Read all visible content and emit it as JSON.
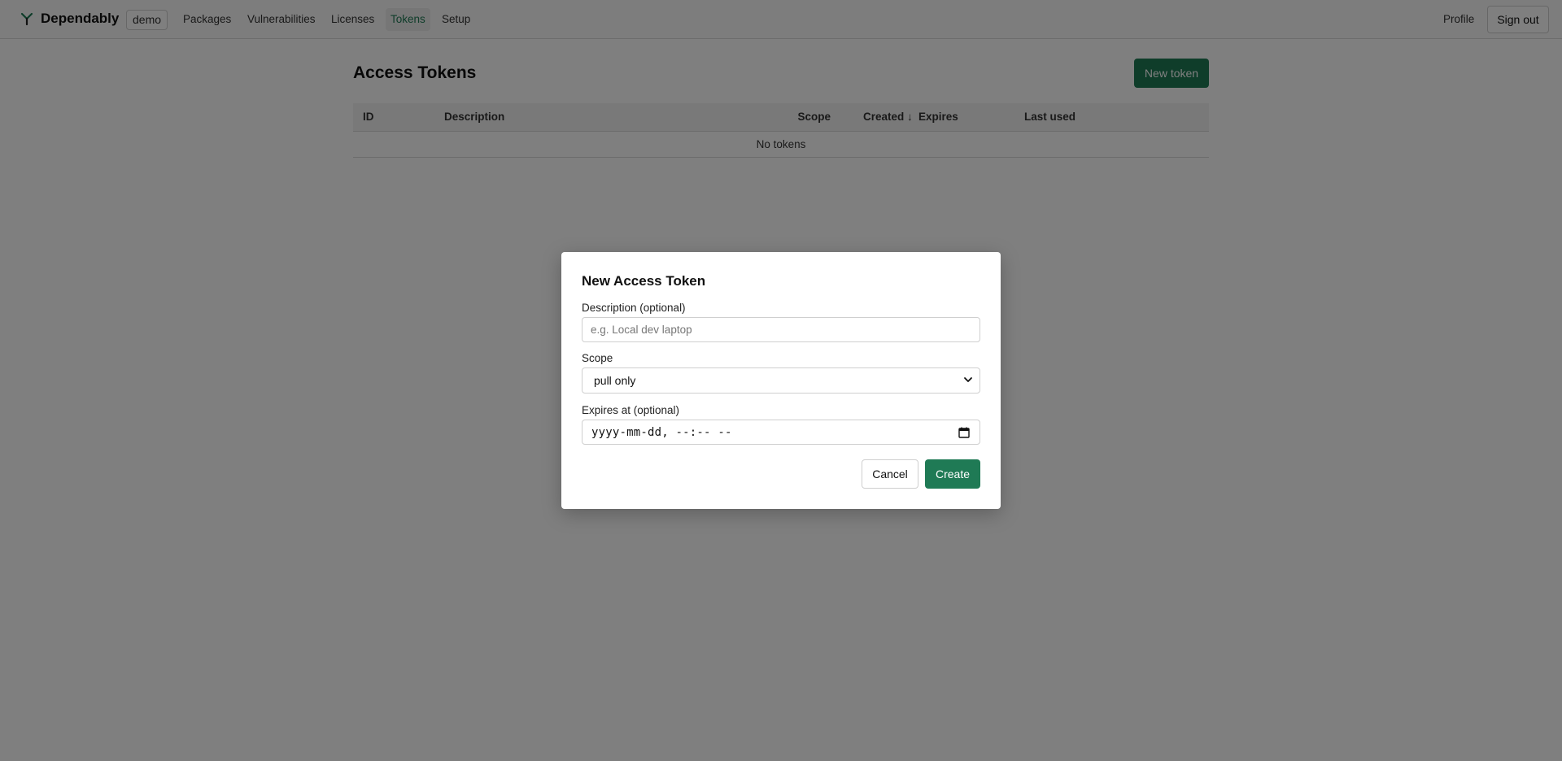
{
  "app": {
    "brand_name": "Dependably",
    "brand_icon": "y-logo-icon",
    "org_badge": "demo"
  },
  "nav": {
    "items": [
      {
        "label": "Packages",
        "active": false
      },
      {
        "label": "Vulnerabilities",
        "active": false
      },
      {
        "label": "Licenses",
        "active": false
      },
      {
        "label": "Tokens",
        "active": true
      },
      {
        "label": "Setup",
        "active": false
      }
    ],
    "profile_label": "Profile",
    "signout_label": "Sign out"
  },
  "main": {
    "title": "Access Tokens",
    "new_token_label": "New token",
    "table": {
      "columns": [
        "ID",
        "Description",
        "Scope",
        "Created ↓",
        "Expires",
        "Last used"
      ],
      "empty_message": "No tokens"
    }
  },
  "modal": {
    "title": "New Access Token",
    "description_label": "Description (optional)",
    "description_placeholder": "e.g. Local dev laptop",
    "description_value": "",
    "scope_label": "Scope",
    "scope_value": "pull only",
    "expires_label": "Expires at (optional)",
    "expires_placeholder": "yyyy-mm-dd, --:-- --",
    "cancel_label": "Cancel",
    "create_label": "Create"
  },
  "colors": {
    "accent": "#1f7a55",
    "overlay": "rgba(0,0,0,0.5)"
  }
}
